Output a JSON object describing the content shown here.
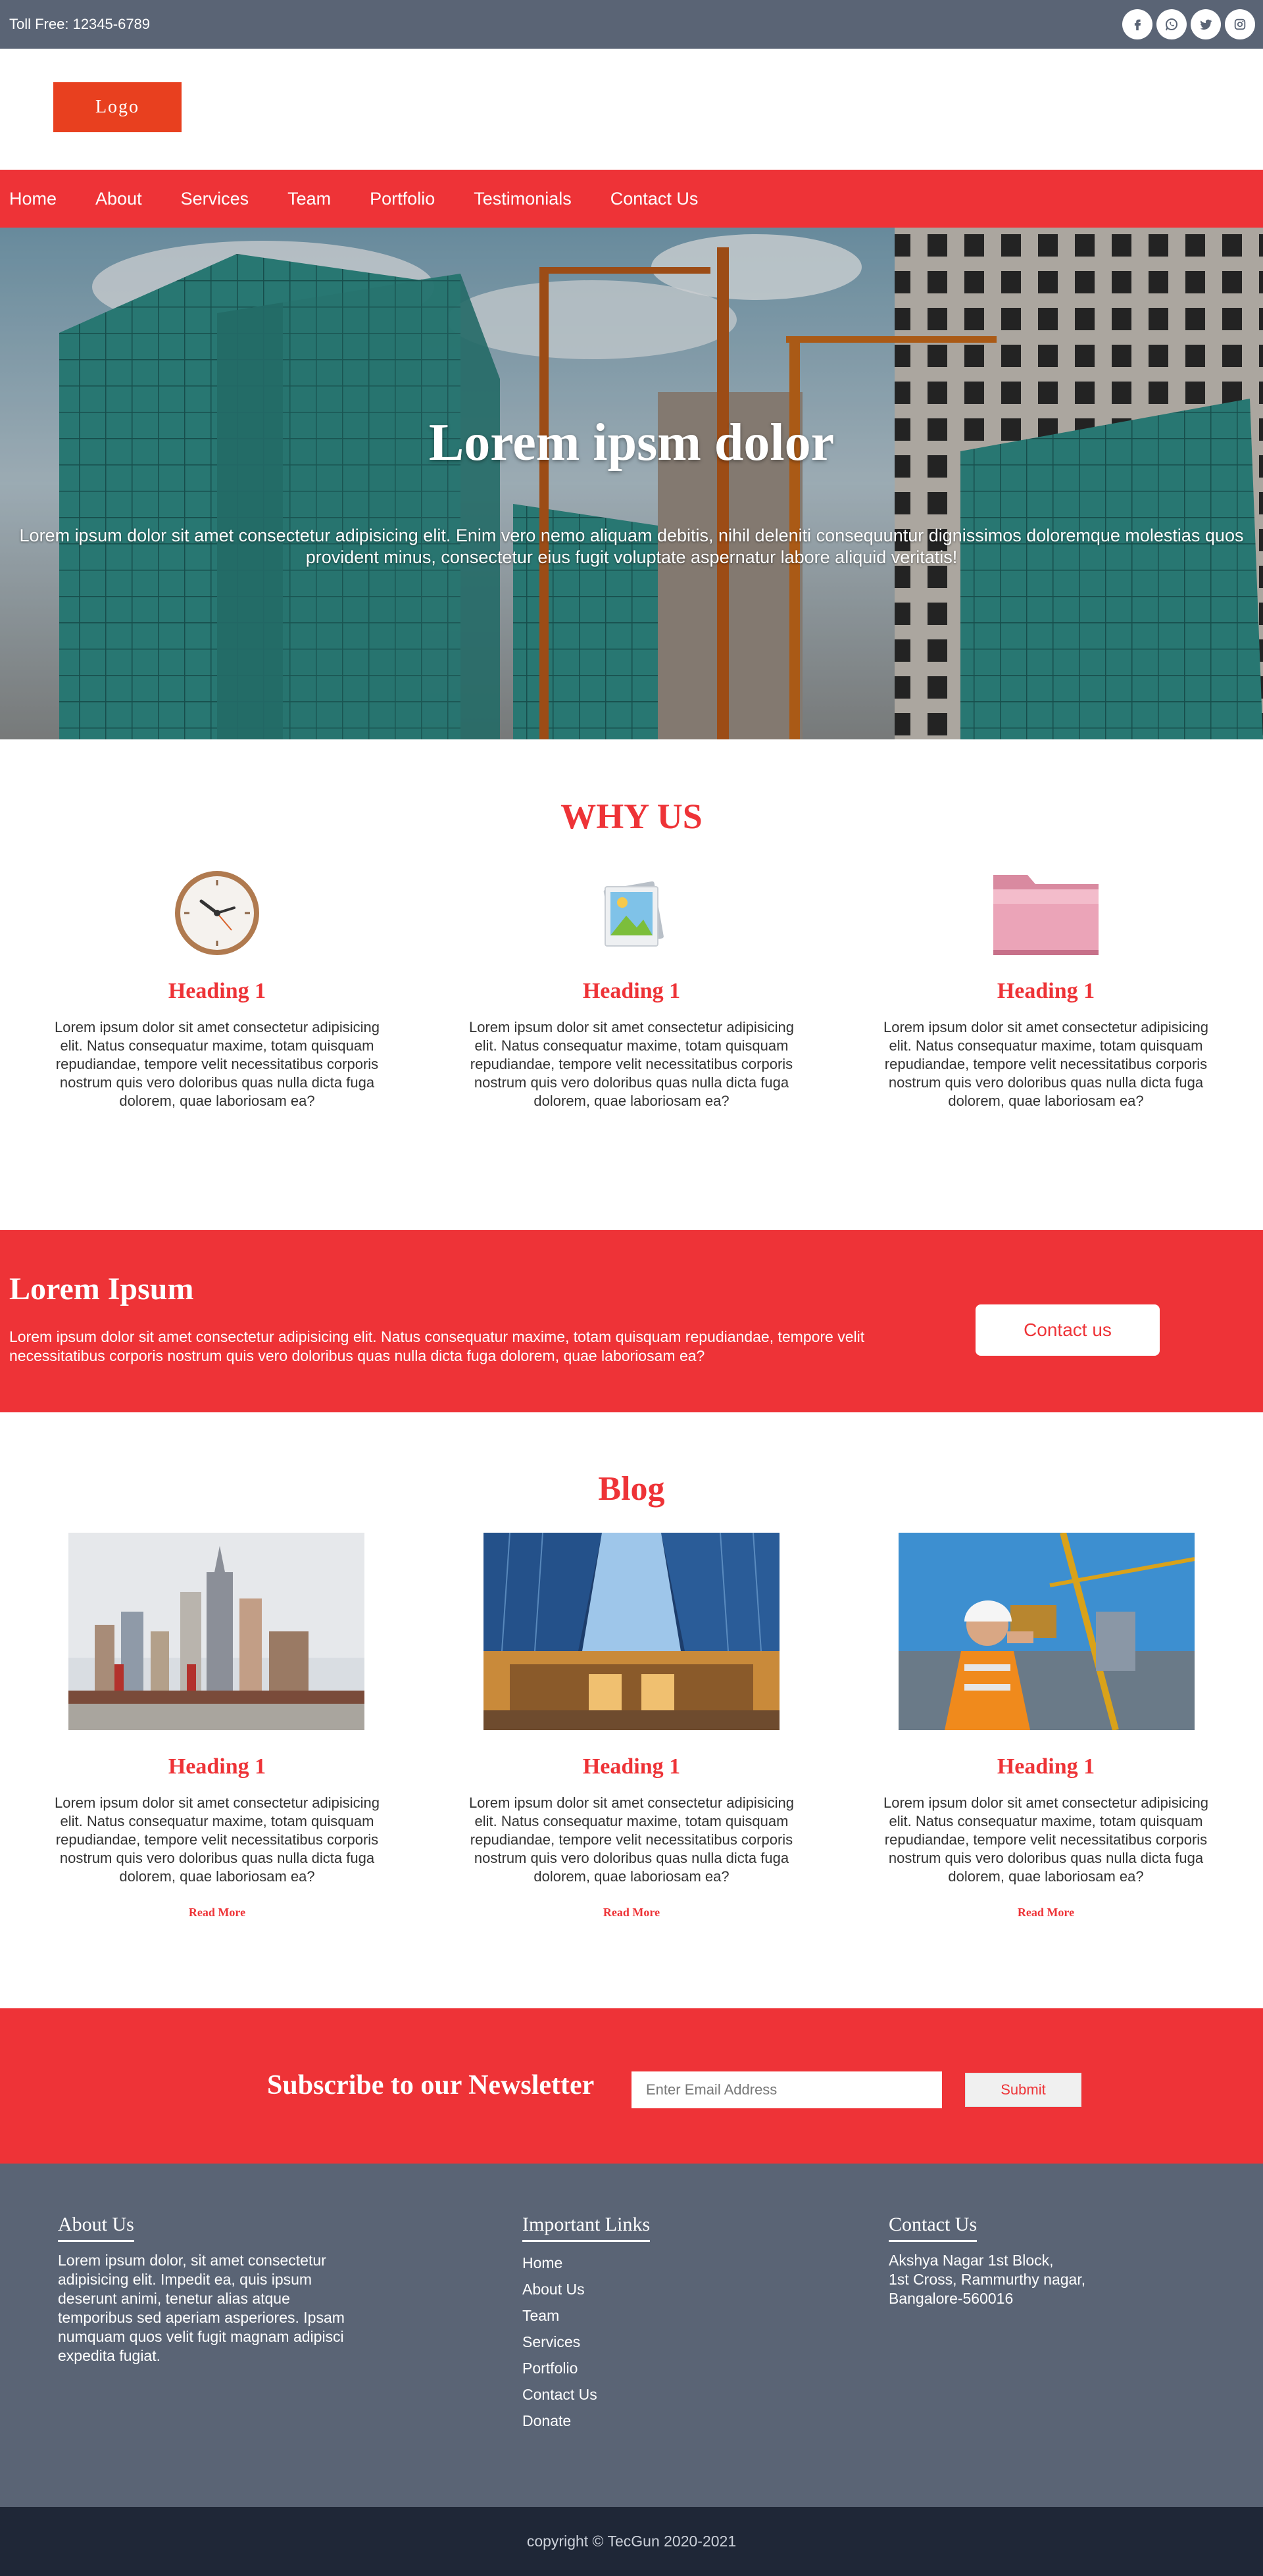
{
  "topbar": {
    "toll_free": "Toll Free: 12345-6789",
    "social_icons": [
      "facebook-icon",
      "whatsapp-icon",
      "twitter-icon",
      "instagram-icon"
    ]
  },
  "logo": {
    "text": "Logo"
  },
  "nav": {
    "items": [
      "Home",
      "About",
      "Services",
      "Team",
      "Portfolio",
      "Testimonials",
      "Contact Us"
    ]
  },
  "hero": {
    "title": "Lorem ipsm dolor",
    "text": "Lorem ipsum dolor sit amet consectetur adipisicing elit. Enim vero nemo aliquam debitis, nihil deleniti consequuntur dignissimos doloremque molestias quos provident minus, consectetur eius fugit voluptate aspernatur labore aliquid veritatis!"
  },
  "why_us": {
    "title": "WHY US",
    "cards": [
      {
        "icon": "clock-icon",
        "heading": "Heading 1",
        "text": "Lorem ipsum dolor sit amet consectetur adipisicing elit. Natus consequatur maxime, totam quisquam repudiandae, tempore velit necessitatibus corporis nostrum quis vero doloribus quas nulla dicta fuga dolorem, quae laboriosam ea?"
      },
      {
        "icon": "image-icon",
        "heading": "Heading 1",
        "text": "Lorem ipsum dolor sit amet consectetur adipisicing elit. Natus consequatur maxime, totam quisquam repudiandae, tempore velit necessitatibus corporis nostrum quis vero doloribus quas nulla dicta fuga dolorem, quae laboriosam ea?"
      },
      {
        "icon": "folder-icon",
        "heading": "Heading 1",
        "text": "Lorem ipsum dolor sit amet consectetur adipisicing elit. Natus consequatur maxime, totam quisquam repudiandae, tempore velit necessitatibus corporis nostrum quis vero doloribus quas nulla dicta fuga dolorem, quae laboriosam ea?"
      }
    ]
  },
  "cta": {
    "title": "Lorem Ipsum",
    "text": "Lorem ipsum dolor sit amet consectetur adipisicing elit. Natus consequatur maxime, totam quisquam repudiandae, tempore velit necessitatibus corporis nostrum quis vero doloribus quas nulla dicta fuga dolorem, quae laboriosam ea?",
    "button": "Contact us"
  },
  "blog": {
    "title": "Blog",
    "posts": [
      {
        "heading": "Heading 1",
        "text": "Lorem ipsum dolor sit amet consectetur adipisicing elit. Natus consequatur maxime, totam quisquam repudiandae, tempore velit necessitatibus corporis nostrum quis vero doloribus quas nulla dicta fuga dolorem, quae laboriosam ea?",
        "link": "Read More"
      },
      {
        "heading": "Heading 1",
        "text": "Lorem ipsum dolor sit amet consectetur adipisicing elit. Natus consequatur maxime, totam quisquam repudiandae, tempore velit necessitatibus corporis nostrum quis vero doloribus quas nulla dicta fuga dolorem, quae laboriosam ea?",
        "link": "Read More"
      },
      {
        "heading": "Heading 1",
        "text": "Lorem ipsum dolor sit amet consectetur adipisicing elit. Natus consequatur maxime, totam quisquam repudiandae, tempore velit necessitatibus corporis nostrum quis vero doloribus quas nulla dicta fuga dolorem, quae laboriosam ea?",
        "link": "Read More"
      }
    ]
  },
  "newsletter": {
    "title": "Subscribe to our Newsletter",
    "placeholder": "Enter Email Address",
    "submit": "Submit"
  },
  "footer": {
    "about": {
      "title": "About Us",
      "text": "Lorem ipsum dolor, sit amet consectetur adipisicing elit. Impedit ea, quis ipsum deserunt animi, tenetur alias atque temporibus sed aperiam asperiores. Ipsam numquam quos velit fugit magnam adipisci expedita fugiat."
    },
    "links": {
      "title": "Important Links",
      "items": [
        "Home",
        "About Us",
        "Team",
        "Services",
        "Portfolio",
        "Contact Us",
        "Donate"
      ]
    },
    "contact": {
      "title": "Contact Us",
      "lines": [
        "Akshya Nagar 1st Block,",
        "1st Cross, Rammurthy nagar,",
        "Bangalore-560016"
      ]
    }
  },
  "copyright": "copyright © TecGun 2020-2021",
  "colors": {
    "accent": "#ee3337",
    "dark": "#5a6475",
    "darker": "#1f2737"
  }
}
